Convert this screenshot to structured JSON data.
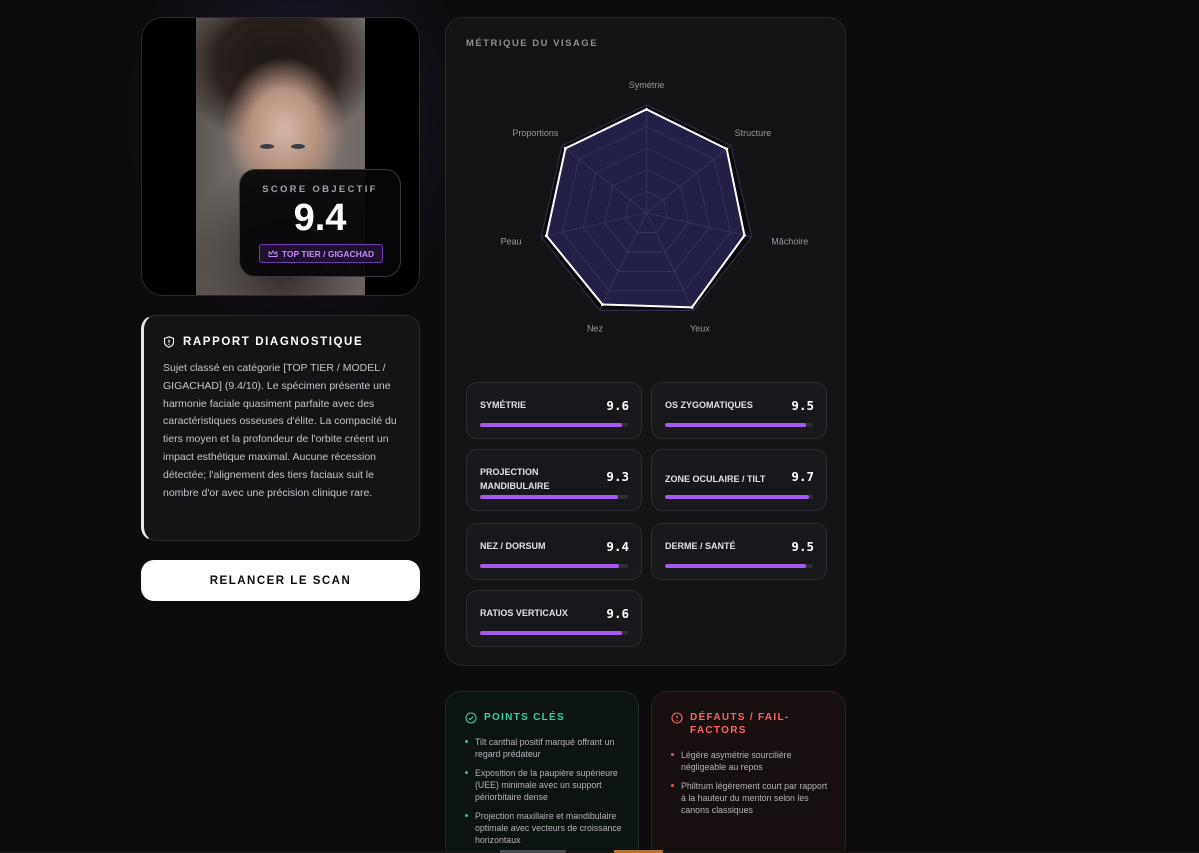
{
  "photo": {
    "score_label": "SCORE OBJECTIF",
    "score_value": "9.4",
    "tier_badge": "TOP TIER / GIGACHAD",
    "badge_icon": "crown-icon"
  },
  "report": {
    "title": "RAPPORT DIAGNOSTIQUE",
    "icon": "shield-alert-icon",
    "text": "Sujet classé en catégorie [TOP TIER / MODEL / GIGACHAD] (9.4/10). Le spécimen présente une harmonie faciale quasiment parfaite avec des caractéristiques osseuses d'élite. La compacité du tiers moyen et la profondeur de l'orbite créent un impact esthétique maximal. Aucune récession détectée; l'alignement des tiers faciaux suit le nombre d'or avec une précision clinique rare."
  },
  "rescan_button": "RELANCER LE SCAN",
  "metrics": {
    "title": "MÉTRIQUE DU VISAGE",
    "cards": [
      {
        "label": "SYMÉTRIE",
        "value": "9.6",
        "score": 9.6
      },
      {
        "label": "OS ZYGOMATIQUES",
        "value": "9.5",
        "score": 9.5
      },
      {
        "label": "PROJECTION MANDIBULAIRE",
        "value": "9.3",
        "score": 9.3
      },
      {
        "label": "ZONE OCULAIRE / TILT",
        "value": "9.7",
        "score": 9.7
      },
      {
        "label": "NEZ / DORSUM",
        "value": "9.4",
        "score": 9.4
      },
      {
        "label": "DERME / SANTÉ",
        "value": "9.5",
        "score": 9.5
      },
      {
        "label": "RATIOS VERTICAUX",
        "value": "9.6",
        "score": 9.6
      }
    ]
  },
  "chart_data": {
    "type": "radar",
    "categories": [
      "Symétrie",
      "Structure",
      "Mâchoire",
      "Yeux",
      "Nez",
      "Peau",
      "Proportions"
    ],
    "values": [
      9.6,
      9.5,
      9.3,
      9.7,
      9.4,
      9.5,
      9.6
    ],
    "range": [
      0,
      10
    ],
    "grid": true,
    "colors": {
      "fill": "#232047",
      "stroke": "#ffffff",
      "grid": "#3a3860"
    }
  },
  "strengths": {
    "title": "POINTS CLÉS",
    "icon": "check-circle-icon",
    "items": [
      "Tilt canthal positif marqué offrant un regard prédateur",
      "Exposition de la paupière supérieure (UEE) minimale avec un support périorbitaire dense",
      "Projection maxillaire et mandibulaire optimale avec vecteurs de croissance horizontaux"
    ]
  },
  "flaws": {
    "title": "DÉFAUTS / FAIL-FACTORS",
    "icon": "alert-circle-icon",
    "items": [
      "Légère asymétrie sourcilière négligeable au repos",
      "Philtrum légèrement court par rapport à la hauteur du menton selon les canons classiques"
    ]
  }
}
